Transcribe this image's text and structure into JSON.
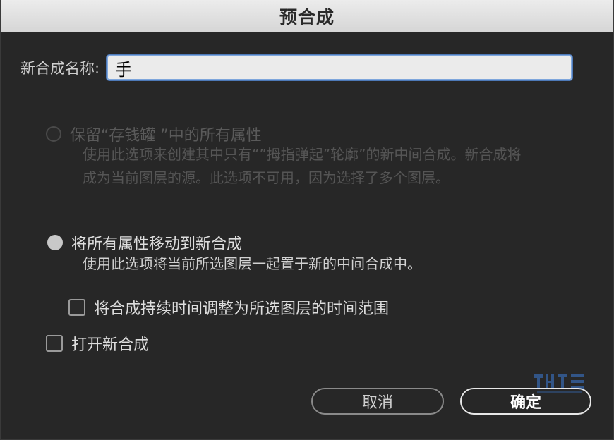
{
  "window": {
    "title": "预合成"
  },
  "name_field": {
    "label": "新合成名称:",
    "value": "手"
  },
  "option_keep": {
    "label": "保留“存钱罐 ”中的所有属性",
    "description_line1": "使用此选项来创建其中只有“”拇指弹起”轮廓”的新中间合成。新合成将",
    "description_line2": "成为当前图层的源。此选项不可用，因为选择了多个图层。",
    "enabled": false
  },
  "option_move": {
    "label": "将所有属性移动到新合成",
    "description": "使用此选项将当前所选图层一起置于新的中间合成中。",
    "selected": true
  },
  "checkbox_adjust": {
    "label": "将合成持续时间调整为所选图层的时间范围",
    "checked": false
  },
  "checkbox_open": {
    "label": "打开新合成",
    "checked": false
  },
  "buttons": {
    "cancel": "取消",
    "ok": "确定"
  },
  "colors": {
    "dialog_bg": "#272727",
    "focus_ring": "#7ea6dc",
    "watermark": "#3b7bd6"
  },
  "icons": {
    "watermark": "watermark-logo-icon"
  }
}
